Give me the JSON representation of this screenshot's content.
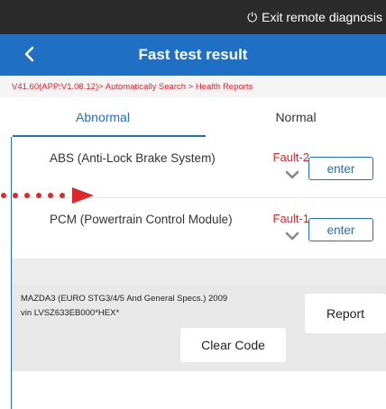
{
  "status_bar": {
    "power_icon": "power-icon",
    "exit_label": "Exit remote diagnosis"
  },
  "header": {
    "title": "Fast test result",
    "back_icon": "chevron-left-icon"
  },
  "breadcrumb": "V41.60(APP:V1.08.12)> Automatically Search > Health Reports",
  "tabs": [
    {
      "label": "Abnormal",
      "active": true
    },
    {
      "label": "Normal",
      "active": false
    }
  ],
  "faults": [
    {
      "name": "ABS (Anti-Lock Brake System)",
      "status": "Fault-2",
      "button": "enter"
    },
    {
      "name": "PCM (Powertrain Control Module)",
      "status": "Fault-1",
      "button": "enter"
    }
  ],
  "vehicle": {
    "line1": "MAZDA3 (EURO STG3/4/5 And General Specs.) 2009",
    "line2": "vin LVSZ633EB000*HEX*"
  },
  "actions": {
    "report": "Report",
    "clear_code": "Clear Code"
  },
  "colors": {
    "brand": "#1f6fc4",
    "fault": "#e0262b",
    "status_bar": "#2b2b2b"
  }
}
